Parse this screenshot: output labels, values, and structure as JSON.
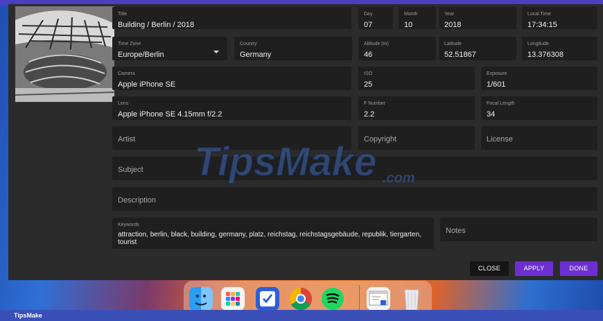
{
  "dialog": {
    "fields": {
      "title": {
        "label": "Title",
        "value": "Building / Berlin / 2018"
      },
      "day": {
        "label": "Day",
        "value": "07"
      },
      "month": {
        "label": "Month",
        "value": "10"
      },
      "year": {
        "label": "Year",
        "value": "2018"
      },
      "local_time": {
        "label": "Local Time",
        "value": "17:34:15"
      },
      "time_zone": {
        "label": "Time Zone",
        "value": "Europe/Berlin"
      },
      "country": {
        "label": "Country",
        "value": "Germany"
      },
      "altitude": {
        "label": "Altitude (m)",
        "value": "46"
      },
      "latitude": {
        "label": "Latitude",
        "value": "52.51867"
      },
      "longitude": {
        "label": "Longitude",
        "value": "13.376308"
      },
      "camera": {
        "label": "Camera",
        "value": "Apple iPhone SE"
      },
      "iso": {
        "label": "ISO",
        "value": "25"
      },
      "exposure": {
        "label": "Exposure",
        "value": "1/601"
      },
      "lens": {
        "label": "Lens",
        "value": "Apple iPhone SE 4.15mm f/2.2"
      },
      "f_number": {
        "label": "F Number",
        "value": "2.2"
      },
      "focal_length": {
        "label": "Focal Length",
        "value": "34"
      },
      "artist": {
        "placeholder": "Artist"
      },
      "copyright": {
        "placeholder": "Copyright"
      },
      "license": {
        "placeholder": "License"
      },
      "subject": {
        "placeholder": "Subject"
      },
      "description": {
        "placeholder": "Description"
      },
      "keywords": {
        "label": "Keywords",
        "value": "attraction, berlin, black, building, germany, platz, reichstag, reichstagsgebäude, republik, tiergarten, tourist"
      },
      "notes": {
        "placeholder": "Notes"
      }
    },
    "buttons": {
      "close": "CLOSE",
      "apply": "APPLY",
      "done": "DONE"
    }
  },
  "watermark": {
    "brand": "TipsMake",
    "suffix": ".com"
  },
  "dock": {
    "icons": [
      "finder-icon",
      "launchpad-icon",
      "preview-icon",
      "chrome-icon",
      "spotify-icon",
      "document-icon",
      "trash-icon"
    ]
  },
  "footer": {
    "label": "TipsMake"
  },
  "colors": {
    "accent": "#6d2fd2",
    "field_bg": "#1f1f1f",
    "dialog_bg": "#2b2b2b"
  }
}
